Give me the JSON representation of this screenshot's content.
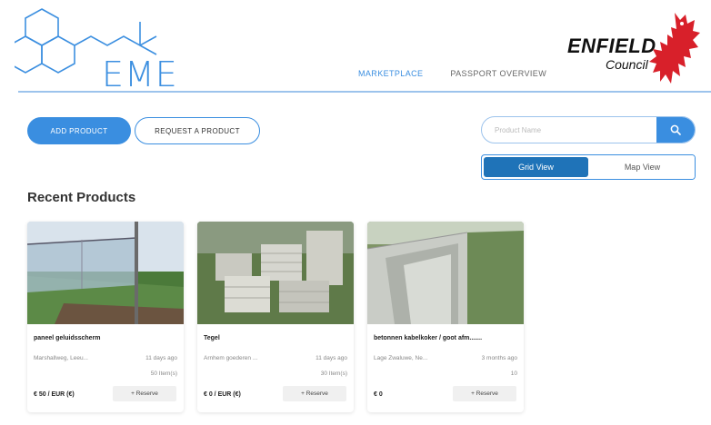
{
  "brand": {
    "logo_text": "EME",
    "council_name": "ENFIELD",
    "council_sub": "Council"
  },
  "nav": {
    "items": [
      {
        "label": "MARKETPLACE",
        "active": true
      },
      {
        "label": "PASSPORT OVERVIEW",
        "active": false
      }
    ]
  },
  "actions": {
    "add_product": "ADD PRODUCT",
    "request_product": "REQUEST A PRODUCT"
  },
  "search": {
    "placeholder": "Product Name",
    "icon": "search-icon"
  },
  "view_toggle": {
    "grid": "Grid View",
    "map": "Map View",
    "selected": "grid"
  },
  "section": {
    "title": "Recent Products"
  },
  "products": [
    {
      "title": "paneel geluidsscherm",
      "location": "Marshallweg, Leeu...",
      "time": "11 days ago",
      "items": "50 Item(s)",
      "price": "€ 50 / EUR (€)",
      "reserve": "+ Reserve"
    },
    {
      "title": "Tegel",
      "location": "Arnhem goederen ...",
      "time": "11 days ago",
      "items": "30 Item(s)",
      "price": "€ 0 / EUR (€)",
      "reserve": "+ Reserve"
    },
    {
      "title": "betonnen kabelkoker / goot afm.......",
      "location": "Lage Zwaluwe, Ne...",
      "time": "3 months ago",
      "items": "10",
      "price": "€ 0",
      "reserve": "+ Reserve"
    }
  ],
  "colors": {
    "accent": "#3a8ee0",
    "toggle_active": "#1f73b8",
    "council_red": "#d8202a"
  }
}
